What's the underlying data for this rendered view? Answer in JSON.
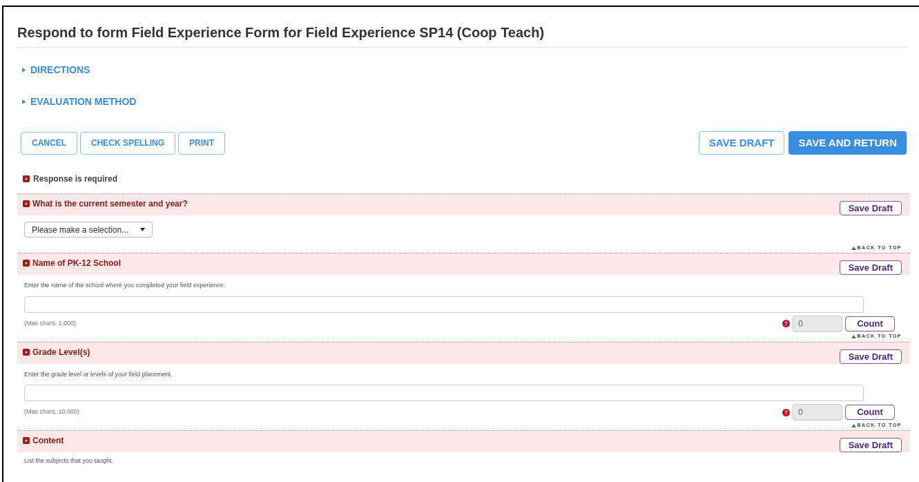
{
  "title": "Respond to form Field Experience Form for Field Experience SP14 (Coop Teach)",
  "sections": [
    {
      "label": "DIRECTIONS",
      "expanded": false
    },
    {
      "label": "EVALUATION METHOD",
      "expanded": false
    }
  ],
  "left_buttons": [
    "CANCEL",
    "CHECK SPELLING",
    "PRINT"
  ],
  "right_buttons": [
    {
      "label": "SAVE DRAFT",
      "kind": "outline"
    },
    {
      "label": "SAVE AND RETURN",
      "kind": "primary"
    }
  ],
  "required_note": "Response is required",
  "questions": [
    {
      "kind": "select",
      "title": "What is the current semester and year?",
      "save_label": "Save Draft",
      "placeholder": "Please make a selection...",
      "back_to_top": "BACK TO TOP"
    },
    {
      "kind": "text",
      "title": "Name of PK-12 School",
      "save_label": "Save Draft",
      "description": "Enter the name of the school where you completed your field experience.",
      "max_chars": "(Max chars: 1,000)",
      "count": "0",
      "count_label": "Count",
      "back_to_top": "BACK TO TOP"
    },
    {
      "kind": "text",
      "title": "Grade Level(s)",
      "save_label": "Save Draft",
      "description": "Enter the grade level or levels of your field placement.",
      "max_chars": "(Max chars: 10,000)",
      "count": "0",
      "count_label": "Count",
      "back_to_top": "BACK TO TOP"
    },
    {
      "kind": "description",
      "title": "Content",
      "save_label": "Save Draft",
      "description": "List the subjects that you taught."
    }
  ]
}
